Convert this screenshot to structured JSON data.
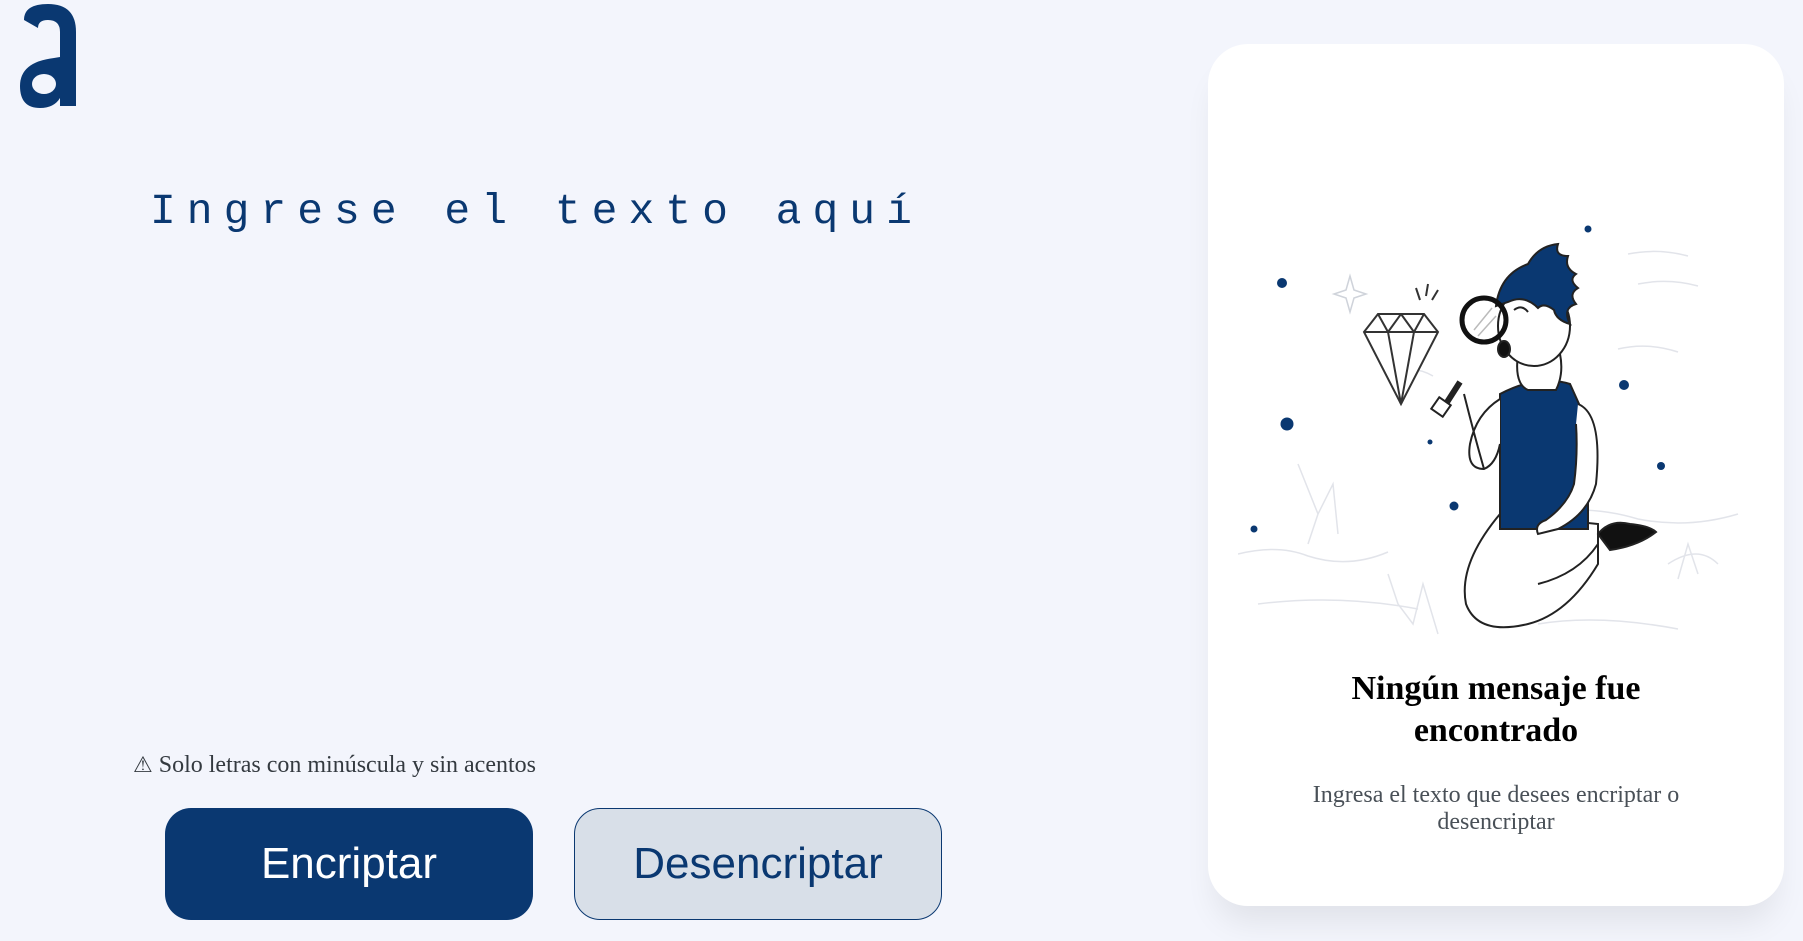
{
  "input": {
    "placeholder": "Ingrese el texto aquí"
  },
  "warning": {
    "icon": "warning-icon",
    "text": "Solo letras con minúscula y sin acentos"
  },
  "buttons": {
    "encrypt_label": "Encriptar",
    "decrypt_label": "Desencriptar"
  },
  "output": {
    "empty_title": "Ningún mensaje fue encontrado",
    "empty_subtitle": "Ingresa el texto que desees encriptar o desencriptar"
  },
  "colors": {
    "background": "#F3F5FC",
    "primary": "#0A3871",
    "secondary_button": "#D8DFE8",
    "panel": "#FFFFFF"
  }
}
